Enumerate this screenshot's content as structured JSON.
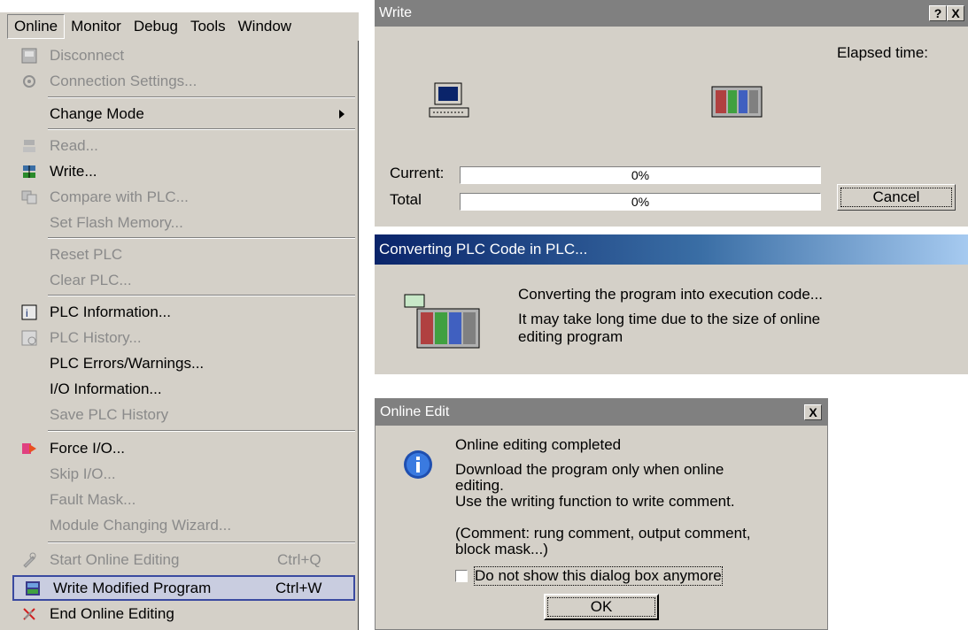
{
  "menubar": {
    "items": [
      "Online",
      "Monitor",
      "Debug",
      "Tools",
      "Window"
    ]
  },
  "menu": {
    "items": [
      {
        "label": "Disconnect",
        "icon": "disconnect-icon",
        "disabled": true
      },
      {
        "label": "Connection Settings...",
        "icon": "connection-settings-icon",
        "disabled": true
      },
      {
        "label": "Change Mode",
        "submenu": true
      },
      {
        "label": "Read...",
        "icon": "read-icon",
        "disabled": true
      },
      {
        "label": "Write...",
        "icon": "write-icon"
      },
      {
        "label": "Compare with PLC...",
        "icon": "compare-icon",
        "disabled": true
      },
      {
        "label": "Set Flash Memory...",
        "disabled": true
      },
      {
        "label": "Reset PLC",
        "disabled": true
      },
      {
        "label": "Clear PLC...",
        "disabled": true
      },
      {
        "label": "PLC Information...",
        "icon": "plc-information-icon"
      },
      {
        "label": "PLC History...",
        "icon": "plc-history-icon",
        "disabled": true
      },
      {
        "label": "PLC Errors/Warnings..."
      },
      {
        "label": "I/O Information..."
      },
      {
        "label": "Save PLC History",
        "disabled": true
      },
      {
        "label": "Force I/O...",
        "icon": "force-io-icon"
      },
      {
        "label": "Skip I/O...",
        "disabled": true
      },
      {
        "label": "Fault Mask...",
        "disabled": true
      },
      {
        "label": "Module Changing Wizard...",
        "disabled": true
      },
      {
        "label": "Start Online Editing",
        "shortcut": "Ctrl+Q",
        "icon": "start-online-editing-icon",
        "disabled": true
      },
      {
        "label": "Write Modified Program",
        "shortcut": "Ctrl+W",
        "icon": "write-modified-icon",
        "highlighted": true
      },
      {
        "label": "End Online Editing",
        "icon": "end-online-editing-icon"
      }
    ]
  },
  "write_dialog": {
    "title": "Write",
    "help_button": "?",
    "close_button": "X",
    "elapsed_label": "Elapsed time:",
    "current_label": "Current:",
    "current_value": "0%",
    "current_progress": 0,
    "total_label": "Total",
    "total_value": "0%",
    "total_progress": 0,
    "cancel_label": "Cancel"
  },
  "converting_dialog": {
    "title": "Converting PLC Code in PLC...",
    "line1": "Converting the program into execution code...",
    "line2": "It may take long time due to the size of online",
    "line3": "editing program"
  },
  "online_edit_dialog": {
    "title": "Online Edit",
    "close_button": "X",
    "heading": "Online editing completed",
    "msg1": "Download the program only when online",
    "msg2": "editing.",
    "msg3": "Use the writing function to write comment.",
    "msg4": "(Comment: rung comment, output comment,",
    "msg5": "block mask...)",
    "checkbox_label": "Do not show this dialog box anymore",
    "checkbox_checked": false,
    "ok_label": "OK"
  },
  "colors": {
    "dialog_face": "#d4d0c8",
    "active_title_start": "#0a246a",
    "active_title_end": "#a6caf0",
    "inactive_title": "#808080"
  }
}
